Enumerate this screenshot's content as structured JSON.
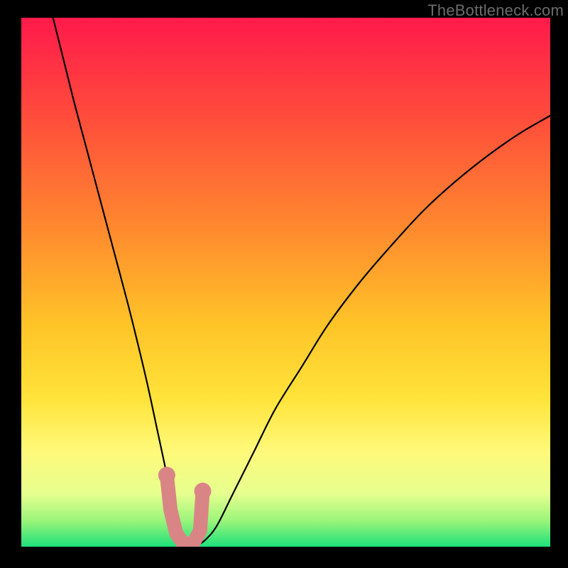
{
  "watermark": "TheBottleneck.com",
  "chart_data": {
    "type": "line",
    "title": "",
    "xlabel": "",
    "ylabel": "",
    "xlim": [
      0,
      100
    ],
    "ylim": [
      0,
      100
    ],
    "grid": false,
    "legend": false,
    "gradient_stops": [
      {
        "offset": 0.0,
        "color": "#ff1a4b"
      },
      {
        "offset": 0.18,
        "color": "#ff4a3c"
      },
      {
        "offset": 0.4,
        "color": "#ff8a2e"
      },
      {
        "offset": 0.58,
        "color": "#ffc428"
      },
      {
        "offset": 0.72,
        "color": "#ffe33a"
      },
      {
        "offset": 0.82,
        "color": "#fff97a"
      },
      {
        "offset": 0.9,
        "color": "#e6ff8f"
      },
      {
        "offset": 0.95,
        "color": "#9cf57a"
      },
      {
        "offset": 1.0,
        "color": "#1ee07a"
      }
    ],
    "series": [
      {
        "name": "bottleneck-curve",
        "stroke": "#000000",
        "stroke_width": 2.2,
        "x": [
          6,
          8,
          10,
          12,
          14,
          16,
          18,
          20,
          22,
          24,
          25.5,
          27,
          28,
          29,
          30,
          31,
          31.5,
          32,
          33.5,
          35,
          37,
          40,
          44,
          48,
          53,
          58,
          64,
          70,
          76,
          82,
          88,
          94,
          100
        ],
        "y": [
          100,
          92,
          84,
          76.5,
          69,
          61.5,
          54,
          46.5,
          38.5,
          30,
          23,
          16,
          11,
          7,
          3.5,
          1.2,
          0.4,
          0.2,
          0.4,
          1.5,
          4,
          10,
          18,
          26,
          34,
          42,
          50,
          57,
          63.5,
          69,
          73.8,
          78,
          81.5
        ]
      },
      {
        "name": "highlight-marker",
        "type": "scatter",
        "stroke": "#d98585",
        "fill": "#d98585",
        "radius": 10,
        "x": [
          27.5,
          28.2,
          29.3,
          30.5,
          31.5,
          32.6,
          33.8,
          34.3
        ],
        "y": [
          13.5,
          7.0,
          2.5,
          0.8,
          0.5,
          0.8,
          3.0,
          10.5
        ]
      }
    ]
  }
}
